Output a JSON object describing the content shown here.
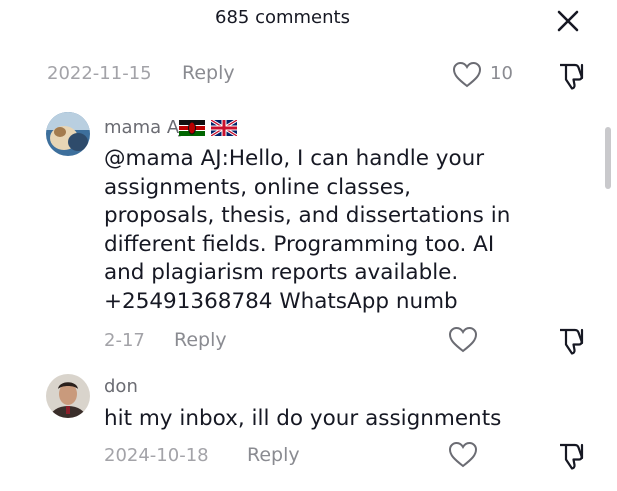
{
  "header": {
    "title": "685 comments",
    "close_icon": "close-icon"
  },
  "prev_comment_footer": {
    "date": "2022-11-15",
    "reply_label": "Reply",
    "like_count": "10",
    "like_icon": "heart-outline-icon",
    "dislike_icon": "thumbs-down-icon"
  },
  "comments": [
    {
      "username": "mama AJ",
      "flags": [
        "kenya-flag-icon",
        "uk-flag-icon"
      ],
      "text": "@mama AJ:Hello, I can handle your\nassignments, online classes,\nproposals, thesis, and dissertations in\ndifferent fields. Programming too. AI\nand plagiarism reports available.\n+25491368784 WhatsApp numb",
      "date": "2-17",
      "reply_label": "Reply",
      "like_icon": "heart-outline-icon",
      "dislike_icon": "thumbs-down-icon"
    },
    {
      "username": "don",
      "text": "hit my inbox, ill do your assignments",
      "date": "2024-10-18",
      "reply_label": "Reply",
      "like_icon": "heart-outline-icon",
      "dislike_icon": "thumbs-down-icon"
    }
  ],
  "colors": {
    "text_primary": "#161823",
    "text_secondary": "#8a8b91",
    "text_tertiary": "#a3a3a8",
    "background": "#ffffff"
  }
}
